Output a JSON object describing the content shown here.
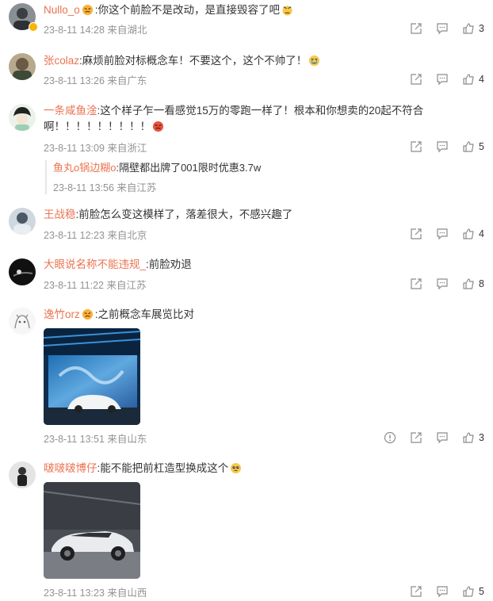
{
  "comments": [
    {
      "username": "Nullo_o",
      "text": ":你这个前脸不是改动，是直接毁容了吧",
      "time": "23-8-11 14:28",
      "location": "来自湖北",
      "likes": "3"
    },
    {
      "username": "张colaz",
      "text": ":麻烦前脸对标概念车！不要这个，这个不帅了！",
      "time": "23-8-11 13:26",
      "location": "来自广东",
      "likes": "4"
    },
    {
      "username": "一条咸鱼淦",
      "text": ":这个样子乍一看感觉15万的零跑一样了！根本和你想卖的20起不符合啊！！！！！！！！！",
      "time": "23-8-11 13:09",
      "location": "来自浙江",
      "likes": "5",
      "reply": {
        "username": "鱼丸o锅边糊o",
        "text": ":隔壁都出牌了001限时优惠3.7w",
        "time": "23-8-11 13:56",
        "location": "来自江苏"
      }
    },
    {
      "username": "王战稳",
      "text": ":前脸怎么变这模样了，落差很大，不感兴趣了",
      "time": "23-8-11 12:23",
      "location": "来自北京",
      "likes": "4"
    },
    {
      "username": "大眼说名称不能违规_",
      "text": ":前脸劝退",
      "time": "23-8-11 11:22",
      "location": "来自江苏",
      "likes": "8"
    },
    {
      "username": "逸竹orz",
      "text": ":之前概念车展览比对",
      "time": "23-8-11 13:51",
      "location": "来自山东",
      "likes": "3"
    },
    {
      "username": "啵啵啵博仔",
      "text": ":能不能把前杠造型换成这个",
      "time": "23-8-11 13:23",
      "location": "来自山西",
      "likes": "5"
    }
  ],
  "icons": {
    "share": "share-icon",
    "comment": "comment-icon",
    "like": "thumbs-up-icon",
    "report": "report-icon"
  },
  "colors": {
    "username": "#eb7350",
    "text": "#333333",
    "meta": "#939393"
  }
}
